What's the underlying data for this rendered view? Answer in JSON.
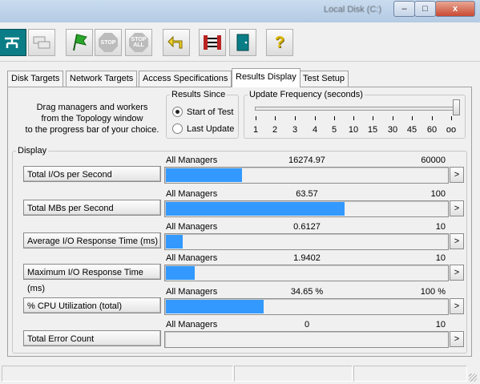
{
  "window": {
    "title": "Local Disk (C:)",
    "minimize_label": "–",
    "maximize_label": "□",
    "close_label": "x"
  },
  "toolbar": {
    "stop_label": "STOP",
    "stop_all_label_1": "STOP",
    "stop_all_label_2": "ALL",
    "help_label": "?"
  },
  "tabs": [
    {
      "label": "Disk Targets",
      "active": false
    },
    {
      "label": "Network Targets",
      "active": false
    },
    {
      "label": "Access Specifications",
      "active": false
    },
    {
      "label": "Results Display",
      "active": true
    },
    {
      "label": "Test Setup",
      "active": false
    }
  ],
  "hint": {
    "line1": "Drag managers and workers",
    "line2": "from the Topology window",
    "line3": "to the progress bar of your choice."
  },
  "results_since": {
    "legend": "Results Since",
    "options": [
      {
        "label": "Start of Test",
        "selected": true
      },
      {
        "label": "Last Update",
        "selected": false
      }
    ]
  },
  "update_frequency": {
    "legend": "Update Frequency (seconds)",
    "ticks": [
      "1",
      "2",
      "3",
      "4",
      "5",
      "10",
      "15",
      "30",
      "45",
      "60",
      "oo"
    ],
    "selected": "oo"
  },
  "display": {
    "legend": "Display",
    "arrow_label": ">",
    "rows": [
      {
        "button": "Total I/Os per Second",
        "source": "All Managers",
        "value": "16274.97",
        "max": "60000",
        "fill": 0.271
      },
      {
        "button": "Total MBs per Second",
        "source": "All Managers",
        "value": "63.57",
        "max": "100",
        "fill": 0.636
      },
      {
        "button": "Average I/O Response Time (ms)",
        "source": "All Managers",
        "value": "0.6127",
        "max": "10",
        "fill": 0.061
      },
      {
        "button": "Maximum I/O Response Time (ms)",
        "source": "All Managers",
        "value": "1.9402",
        "max": "10",
        "fill": 0.103
      },
      {
        "button": "% CPU Utilization (total)",
        "source": "All Managers",
        "value": "34.65 %",
        "max": "100 %",
        "fill": 0.3465
      },
      {
        "button": "Total Error Count",
        "source": "All Managers",
        "value": "0",
        "max": "10",
        "fill": 0
      }
    ]
  },
  "colors": {
    "bar_fill": "#3399ff",
    "titlebar": "#c9dcef"
  }
}
